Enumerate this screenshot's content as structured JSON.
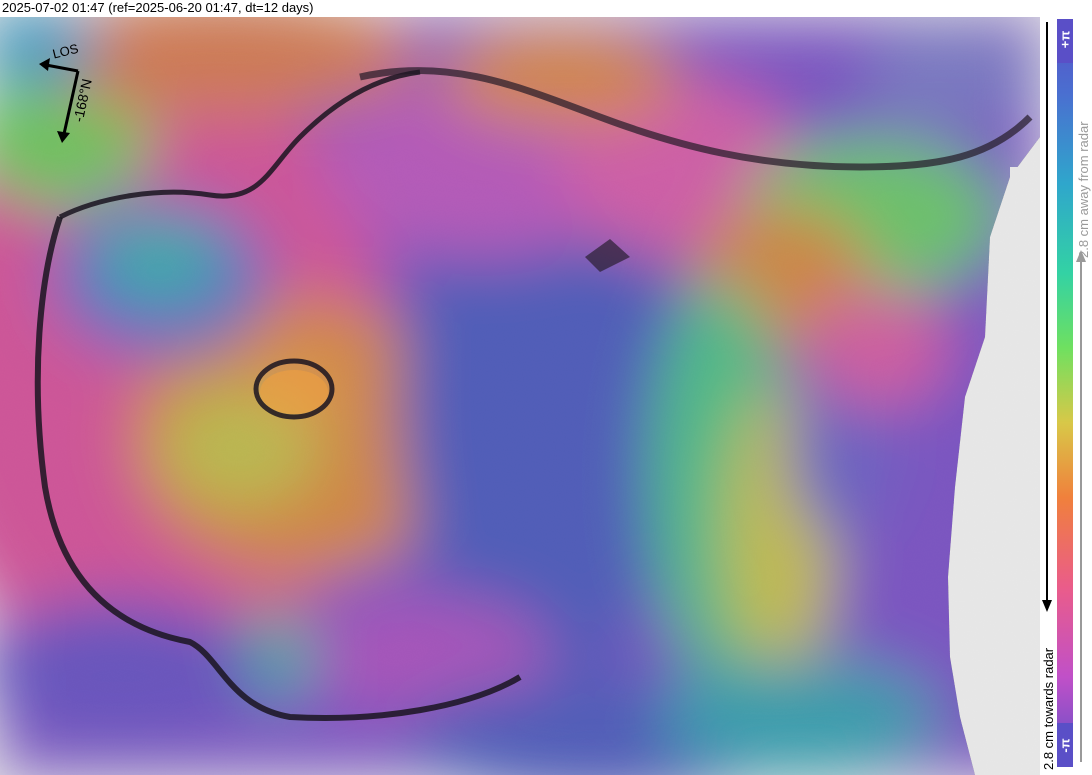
{
  "title": "2025-07-02 01:47 (ref=2025-06-20 01:47, dt=12 days)",
  "map": {
    "compass": {
      "los_label": "LOS",
      "heading_label": "-168°N",
      "arrow_color": "#000000"
    },
    "palette": [
      "#4b4fc9",
      "#3a8fcf",
      "#2fc8b0",
      "#5be36a",
      "#d6d94a",
      "#f08a3a",
      "#e24fb0",
      "#8c4fd0"
    ]
  },
  "colorbar": {
    "top_label": "+π",
    "bottom_label": "-π",
    "away_label": "2.8 cm away from radar",
    "towards_label": "2.8 cm towards radar",
    "label_bg": "#5a4fc7",
    "stops": [
      "#5a4fc7",
      "#3f7fd0",
      "#27b6c6",
      "#3fd98a",
      "#8fe04a",
      "#e9a43a",
      "#f07a3e",
      "#e85aa0",
      "#b14fcf",
      "#5a4fc7"
    ]
  }
}
